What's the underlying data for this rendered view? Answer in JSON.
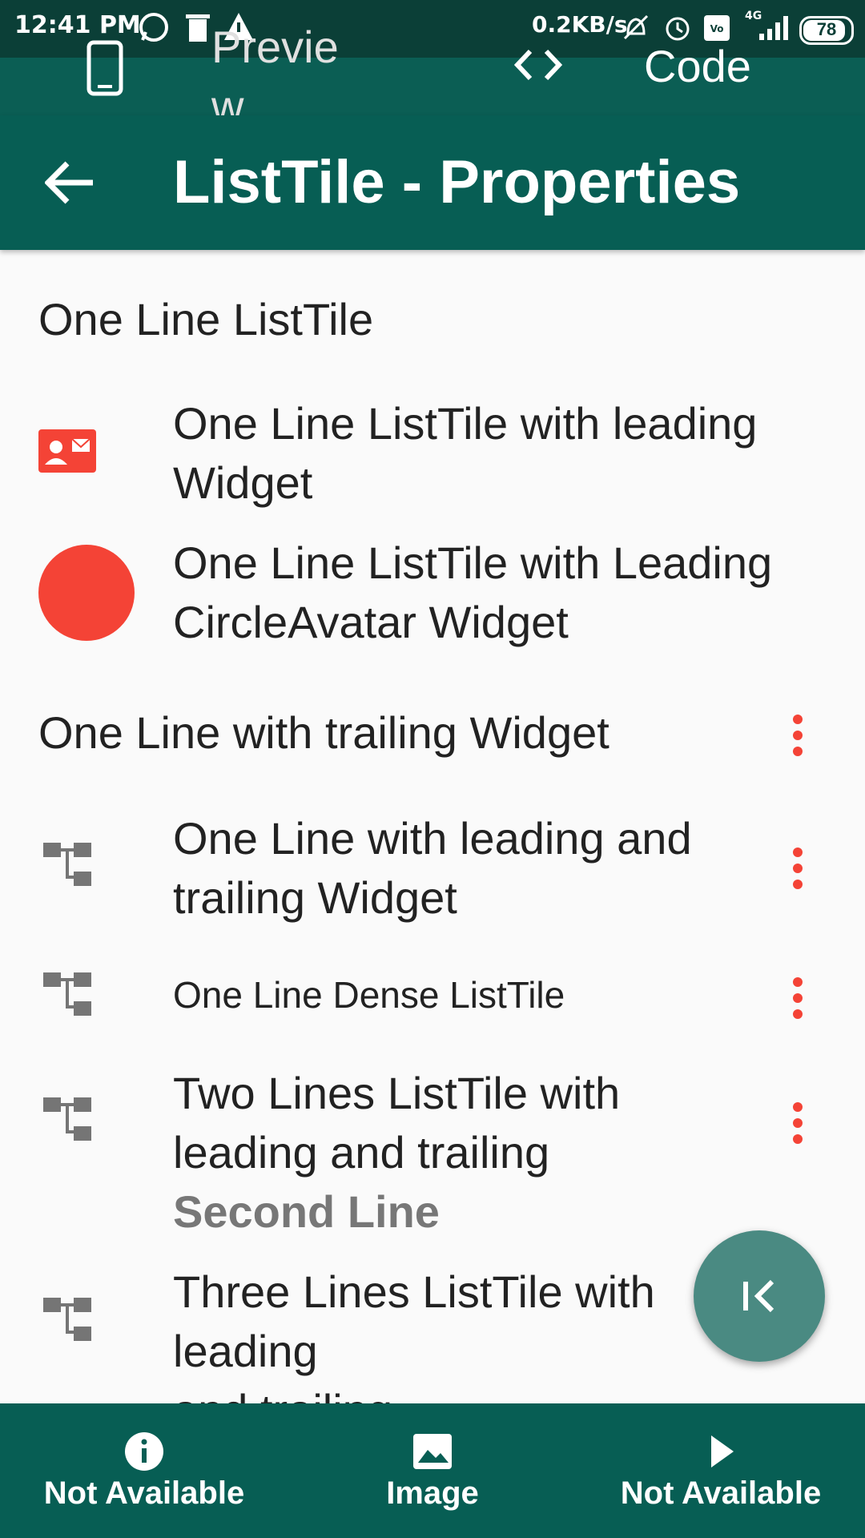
{
  "status_bar": {
    "time": "12:41 PM",
    "net_speed": "0.2KB/s",
    "network": "4G",
    "battery": "78"
  },
  "tabs": {
    "preview_label": "Previe\nw",
    "code_label": "Code"
  },
  "app_bar": {
    "title": "ListTile - Properties"
  },
  "list": {
    "items": [
      {
        "label": "One Line ListTile"
      },
      {
        "label": "One Line ListTile with leading Widget",
        "leading": "contact-mail-icon"
      },
      {
        "label": "One Line ListTile with Leading CircleAvatar Widget",
        "leading": "circle-avatar"
      },
      {
        "label": "One Line with trailing Widget",
        "trailing": "more-vert-icon"
      },
      {
        "label": "One Line with leading and trailing Widget",
        "leading": "account-tree-icon",
        "trailing": "more-vert-icon"
      },
      {
        "label": "One Line Dense ListTile",
        "leading": "account-tree-icon",
        "trailing": "more-vert-icon"
      },
      {
        "label": "Two Lines ListTile with leading and trailing",
        "subtitle": "Second Line",
        "leading": "account-tree-icon",
        "trailing": "more-vert-icon"
      },
      {
        "label": "Three Lines ListTile with leading",
        "label_tail": "and trailing",
        "leading": "account-tree-icon",
        "trailing": "more-vert-icon"
      }
    ]
  },
  "bottom_nav": {
    "items": [
      {
        "label": "Not Available",
        "icon": "info-icon"
      },
      {
        "label": "Image",
        "icon": "image-icon"
      },
      {
        "label": "Not Available",
        "icon": "play-icon"
      }
    ]
  },
  "colors": {
    "primary": "#075e54",
    "accent": "#f44336",
    "icon_grey": "#757575",
    "background": "#fafafa"
  }
}
